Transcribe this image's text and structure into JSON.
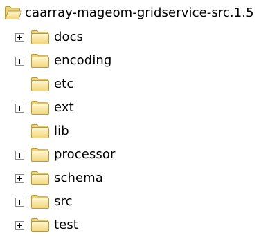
{
  "tree": {
    "root": {
      "label": "caarray-mageom-gridservice-src.1.5",
      "icon": "folder-open-icon"
    },
    "items": [
      {
        "label": "docs",
        "expandable": true
      },
      {
        "label": "encoding",
        "expandable": true
      },
      {
        "label": "etc",
        "expandable": false
      },
      {
        "label": "ext",
        "expandable": true
      },
      {
        "label": "lib",
        "expandable": false
      },
      {
        "label": "processor",
        "expandable": true
      },
      {
        "label": "schema",
        "expandable": true
      },
      {
        "label": "src",
        "expandable": true
      },
      {
        "label": "test",
        "expandable": true
      }
    ]
  },
  "colors": {
    "folder_fill": "#f6e39a",
    "folder_tab": "#efd37a",
    "folder_outline": "#b89a3c",
    "expander_border": "#8c8c8c"
  }
}
